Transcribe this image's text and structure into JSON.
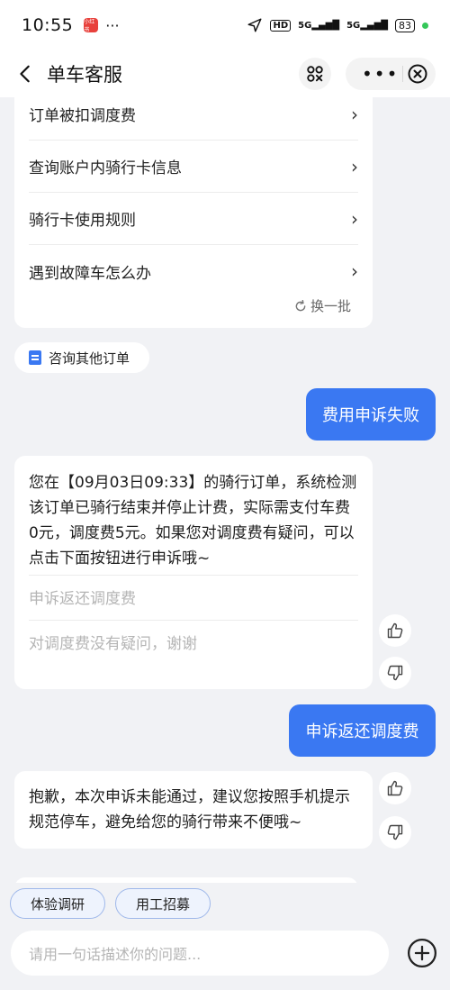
{
  "status_bar": {
    "time": "10:55",
    "app_badge": "小红书",
    "dots": "···",
    "hd": "HD",
    "signal_1": "5G",
    "signal_2": "5G",
    "battery": "83"
  },
  "header": {
    "title": "单车客服"
  },
  "faq": {
    "items": [
      {
        "label": "订单被扣调度费"
      },
      {
        "label": "查询账户内骑行卡信息"
      },
      {
        "label": "骑行卡使用规则"
      },
      {
        "label": "遇到故障车怎么办"
      }
    ],
    "refresh_label": "换一批"
  },
  "other_order": {
    "label": "咨询其他订单"
  },
  "messages": {
    "user_1": "费用申诉失败",
    "bot_1": {
      "text": "您在【09月03日09:33】的骑行订单，系统检测该订单已骑行结束并停止计费，实际需支付车费0元，调度费5元。如果您对调度费有疑问，可以点击下面按钮进行申诉哦~",
      "options": [
        "申诉返还调度费",
        "对调度费没有疑问，谢谢"
      ]
    },
    "user_2": "申诉返还调度费",
    "bot_2": {
      "text": "抱歉，本次申诉未能通过，建议您按照手机提示规范停车，避免给您的骑行带来不便哦~"
    }
  },
  "quick_replies": [
    "体验调研",
    "用工招募"
  ],
  "input": {
    "placeholder": "请用一句话描述你的问题..."
  }
}
